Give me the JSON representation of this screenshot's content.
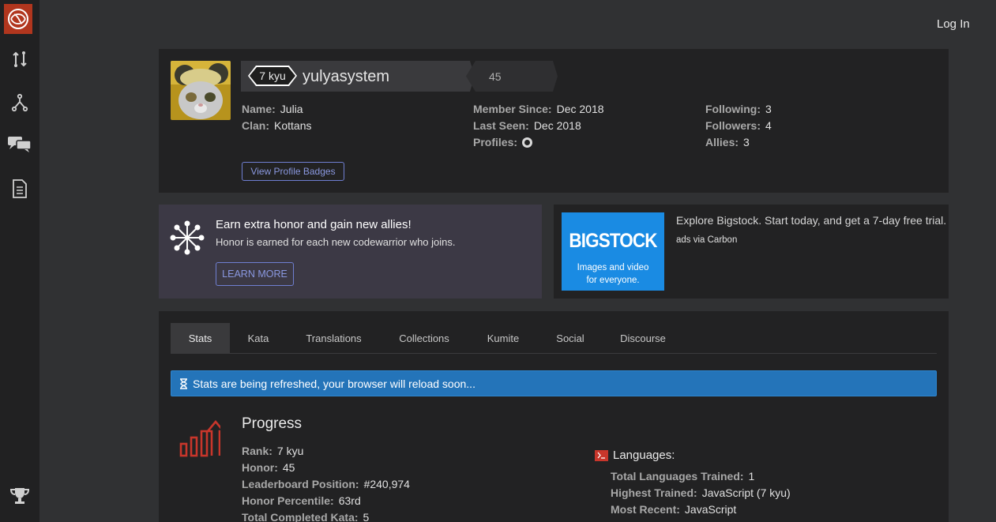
{
  "header": {
    "login_label": "Log In"
  },
  "sidebar": {
    "items": [
      {
        "icon": "codewars-logo-icon"
      },
      {
        "icon": "practice-icon"
      },
      {
        "icon": "fork-icon"
      },
      {
        "icon": "discussions-icon"
      },
      {
        "icon": "docs-icon"
      },
      {
        "icon": "leaderboard-trophy-icon"
      }
    ]
  },
  "profile": {
    "rank": "7 kyu",
    "username": "yulyasystem",
    "honor": "45",
    "fields": {
      "name": {
        "label": "Name:",
        "value": "Julia"
      },
      "clan": {
        "label": "Clan:",
        "value": "Kottans"
      },
      "member_since": {
        "label": "Member Since:",
        "value": "Dec 2018"
      },
      "last_seen": {
        "label": "Last Seen:",
        "value": "Dec 2018"
      },
      "profiles": {
        "label": "Profiles:"
      },
      "following": {
        "label": "Following:",
        "value": "3"
      },
      "followers": {
        "label": "Followers:",
        "value": "4"
      },
      "allies": {
        "label": "Allies:",
        "value": "3"
      }
    },
    "badges_button": "View Profile Badges"
  },
  "promo": {
    "title": "Earn extra honor and gain new allies!",
    "subtitle": "Honor is earned for each new codewarrior who joins.",
    "button": "LEARN MORE"
  },
  "ad": {
    "logo": "BIGSTOCK",
    "tagline_1": "Images and video",
    "tagline_2": "for everyone.",
    "text": "Explore Bigstock. Start today, and get a 7-day free trial.",
    "via": "ads via Carbon"
  },
  "tabs": [
    "Stats",
    "Kata",
    "Translations",
    "Collections",
    "Kumite",
    "Social",
    "Discourse"
  ],
  "alert": "Stats are being refreshed, your browser will reload soon...",
  "progress": {
    "title": "Progress",
    "rows": [
      {
        "label": "Rank:",
        "value": "7 kyu"
      },
      {
        "label": "Honor:",
        "value": "45"
      },
      {
        "label": "Leaderboard Position:",
        "value": "#240,974"
      },
      {
        "label": "Honor Percentile:",
        "value": "63rd"
      },
      {
        "label": "Total Completed Kata:",
        "value": "5"
      }
    ]
  },
  "languages": {
    "title": "Languages:",
    "rows": [
      {
        "label": "Total Languages Trained:",
        "value": "1"
      },
      {
        "label": "Highest Trained:",
        "value": "JavaScript (7 kyu)"
      },
      {
        "label": "Most Recent:",
        "value": "JavaScript"
      }
    ]
  },
  "colors": {
    "accent": "#b1361e",
    "alert": "#2474b9",
    "link": "#6f7fd1"
  }
}
